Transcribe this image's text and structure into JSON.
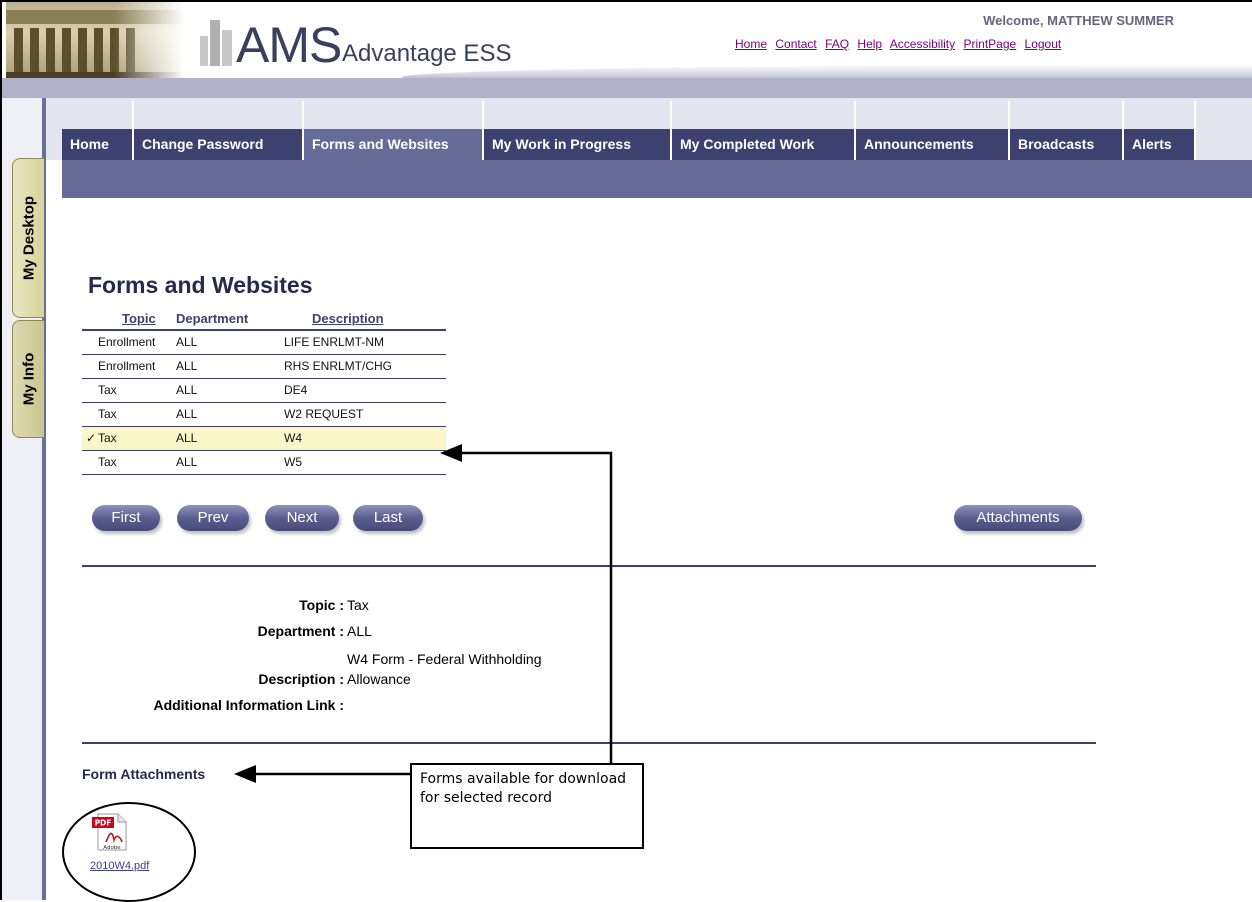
{
  "header": {
    "logo_main": "AMS",
    "logo_sub": "Advantage ESS",
    "welcome": "Welcome, MATTHEW SUMMER",
    "links": [
      "Home",
      "Contact",
      "FAQ",
      "Help",
      "Accessibility",
      "PrintPage",
      "Logout"
    ]
  },
  "side_tabs": {
    "desktop": "My Desktop",
    "info": "My Info"
  },
  "nav_tabs": [
    {
      "label": "Home",
      "active": false
    },
    {
      "label": "Change Password",
      "active": false
    },
    {
      "label": "Forms and Websites",
      "active": true
    },
    {
      "label": "My Work in Progress",
      "active": false
    },
    {
      "label": "My Completed Work",
      "active": false
    },
    {
      "label": "Announcements",
      "active": false
    },
    {
      "label": "Broadcasts",
      "active": false
    },
    {
      "label": "Alerts",
      "active": false
    }
  ],
  "page_title": "Forms and Websites",
  "table": {
    "headers": {
      "topic": "Topic",
      "department": "Department",
      "description": "Description"
    },
    "rows": [
      {
        "topic": "Enrollment",
        "department": "ALL",
        "description": "LIFE ENRLMT-NM",
        "selected": false
      },
      {
        "topic": "Enrollment",
        "department": "ALL",
        "description": "RHS ENRLMT/CHG",
        "selected": false
      },
      {
        "topic": "Tax",
        "department": "ALL",
        "description": "DE4",
        "selected": false
      },
      {
        "topic": "Tax",
        "department": "ALL",
        "description": "W2 REQUEST",
        "selected": false
      },
      {
        "topic": "Tax",
        "department": "ALL",
        "description": "W4",
        "selected": true
      },
      {
        "topic": "Tax",
        "department": "ALL",
        "description": "W5",
        "selected": false
      }
    ],
    "check_mark": "✓"
  },
  "pager": {
    "first": "First",
    "prev": "Prev",
    "next": "Next",
    "last": "Last",
    "attachments": "Attachments"
  },
  "detail": {
    "topic_label": "Topic :",
    "topic_value": "Tax",
    "department_label": "Department :",
    "department_value": "ALL",
    "description_label": "Description :",
    "description_value_line1": "W4 Form - Federal Withholding",
    "description_value_line2": "Allowance",
    "link_label": "Additional Information Link :",
    "link_value": ""
  },
  "attachments": {
    "title": "Form Attachments",
    "file_name": "2010W4.pdf",
    "icon_badge": "PDF",
    "icon_brand": "Adobe"
  },
  "callout": {
    "text": "Forms available for download for selected record"
  },
  "colors": {
    "nav_tab": "#3d4170",
    "nav_active": "#676b97",
    "selected_row": "#fbf6c7",
    "link": "#800080"
  }
}
